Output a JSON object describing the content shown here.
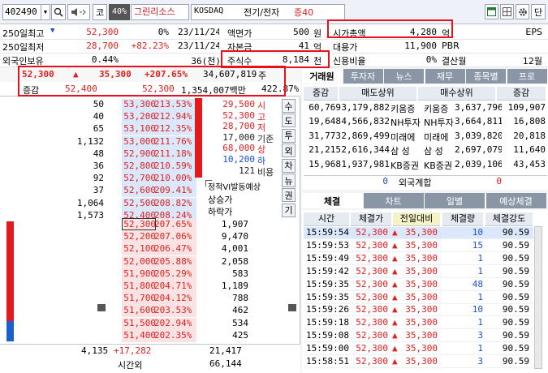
{
  "toolbar": {
    "code": "402490",
    "code_dropdown": "▼",
    "badge1": "코",
    "badge2": "40%",
    "stock_name": "그린리소스",
    "market": "KOSDAQ",
    "sector": "전기/전자",
    "margin": "증40"
  },
  "summary": {
    "left_rows": [
      {
        "label": "250일최고",
        "arrow": "▼",
        "price": "52,300",
        "pct": "0%",
        "date": "23/11/24"
      },
      {
        "label": "250일최저",
        "arrow": "",
        "price": "28,700",
        "pct": "+82.23%",
        "date": "23/11/24"
      },
      {
        "label": "외국인보유",
        "arrow": "",
        "price": "0.44%",
        "pct": "",
        "date": "36(천)"
      }
    ],
    "mid_rows": [
      {
        "label": "액면가",
        "value": "500",
        "unit": "원"
      },
      {
        "label": "자본금",
        "value": "41",
        "unit": "억"
      },
      {
        "label": "주식수",
        "value": "8,184",
        "unit": "천"
      }
    ],
    "right_rows": [
      {
        "label": "시가총액",
        "value": "4,280",
        "unit": "억",
        "label2": "EPS"
      },
      {
        "label": "대용가",
        "value": "11,900",
        "unit": "PBR",
        "label2": ""
      },
      {
        "label": "신용비율",
        "value": "0%",
        "unit": "결산월",
        "label2": "12월"
      }
    ]
  },
  "price_line": {
    "price": "52,300",
    "arrow": "▲",
    "change": "35,300",
    "pct": "+207.65%",
    "volume": "34,607,819",
    "vol_unit": "주"
  },
  "sub_line": {
    "label": "증감",
    "v1": "52,400",
    "v2": "52,300",
    "amount": "1,354,007백만",
    "ratio": "422.87%"
  },
  "orderbook": {
    "ask": [
      {
        "qty": "50",
        "price": "53,300",
        "pct": "213.53%",
        "bar": 0
      },
      {
        "qty": "40",
        "price": "53,200",
        "pct": "212.94%",
        "bar": 0
      },
      {
        "qty": "65",
        "price": "53,100",
        "pct": "212.35%",
        "bar": 0
      },
      {
        "qty": "1,132",
        "price": "53,000",
        "pct": "211.76%",
        "bar": 0
      },
      {
        "qty": "48",
        "price": "52,900",
        "pct": "211.18%",
        "bar": 0
      },
      {
        "qty": "36",
        "price": "52,800",
        "pct": "210.59%",
        "bar": 0
      },
      {
        "qty": "92",
        "price": "52,700",
        "pct": "210.00%",
        "bar": 0
      },
      {
        "qty": "37",
        "price": "52,600",
        "pct": "209.41%",
        "bar": 0
      },
      {
        "qty": "1,064",
        "price": "52,500",
        "pct": "208.82%",
        "bar": 0
      },
      {
        "qty": "1,573",
        "price": "52,400",
        "pct": "208.24%",
        "bar": 0
      }
    ],
    "bid": [
      {
        "qty": "1,907",
        "price": "52,300",
        "pct": "207.65%"
      },
      {
        "qty": "9,470",
        "price": "52,200",
        "pct": "207.06%"
      },
      {
        "qty": "4,001",
        "price": "52,100",
        "pct": "206.47%"
      },
      {
        "qty": "2,058",
        "price": "52,000",
        "pct": "205.88%"
      },
      {
        "qty": "583",
        "price": "51,900",
        "pct": "205.29%"
      },
      {
        "qty": "1,189",
        "price": "51,800",
        "pct": "204.71%"
      },
      {
        "qty": "788",
        "price": "51,700",
        "pct": "204.12%"
      },
      {
        "qty": "462",
        "price": "51,600",
        "pct": "203.53%"
      },
      {
        "qty": "534",
        "price": "51,500",
        "pct": "202.94%"
      },
      {
        "qty": "425",
        "price": "51,400",
        "pct": "202.35%"
      }
    ],
    "info": [
      {
        "label": "시",
        "value": "29,500",
        "cls": "red"
      },
      {
        "label": "고",
        "value": "52,300",
        "cls": "red"
      },
      {
        "label": "저",
        "value": "28,700",
        "cls": "red"
      },
      {
        "label": "기준",
        "value": "17,000",
        "cls": "dk"
      },
      {
        "label": "상",
        "value": "68,000",
        "cls": "red"
      },
      {
        "label": "하",
        "value": "10,200",
        "cls": "blue"
      },
      {
        "label": "비용",
        "value": "121",
        "cls": "dk"
      }
    ],
    "side_tabs": [
      "수",
      "도",
      "투",
      "외",
      "차",
      "뉴",
      "권",
      "기"
    ],
    "vi_label": "정적VI발동예상",
    "vi_up": "상승가",
    "vi_down": "하락가",
    "footer": {
      "ask_total": "4,135",
      "diff": "+17,282",
      "bid_total": "21,417",
      "time_label": "시간외",
      "after_total": "66,144"
    }
  },
  "right_tabs": [
    "거래원",
    "투자자",
    "뉴스",
    "재무",
    "종목별",
    "프로"
  ],
  "broker": {
    "headers": [
      "증감",
      "매도상위",
      "매수상위",
      "증감"
    ],
    "rows": [
      {
        "s_inc": "60,769",
        "s_qty": "3,179,882",
        "s_name": "키움증",
        "b_name": "키움증",
        "b_qty": "3,637,796",
        "b_inc": "109,907"
      },
      {
        "s_inc": "19,648",
        "s_qty": "4,566,832",
        "s_name": "NH투자",
        "b_name": "NH투자",
        "b_qty": "3,664,811",
        "b_inc": "16,808"
      },
      {
        "s_inc": "31,773",
        "s_qty": "2,869,499",
        "s_name": "미래에",
        "b_name": "미래에",
        "b_qty": "3,039,820",
        "b_inc": "20,818"
      },
      {
        "s_inc": "21,215",
        "s_qty": "2,616,344",
        "s_name": "삼 성",
        "b_name": "삼 성",
        "b_qty": "2,697,079",
        "b_inc": "11,640"
      },
      {
        "s_inc": "15,968",
        "s_qty": "1,937,981",
        "s_name": "KB증권",
        "b_name": "KB증권",
        "b_qty": "2,039,106",
        "b_inc": "43,453"
      }
    ],
    "foreign": {
      "left": "0",
      "label": "외국계합",
      "right": "0"
    }
  },
  "trade_tabs": [
    "체결",
    "차트",
    "일별",
    "예상체결"
  ],
  "trades": {
    "headers": [
      "시간",
      "체결가",
      "전일대비",
      "체결량",
      "체결강도"
    ],
    "rows": [
      {
        "time": "15:59:54",
        "price": "52,300",
        "arrow": "▲",
        "chg": "35,300",
        "qty": "10",
        "str": "90.59"
      },
      {
        "time": "15:59:53",
        "price": "52,300",
        "arrow": "▲",
        "chg": "35,300",
        "qty": "15",
        "str": "90.59"
      },
      {
        "time": "15:59:49",
        "price": "52,300",
        "arrow": "▲",
        "chg": "35,300",
        "qty": "1",
        "str": "90.59"
      },
      {
        "time": "15:59:42",
        "price": "52,300",
        "arrow": "▲",
        "chg": "35,300",
        "qty": "1",
        "str": "90.59"
      },
      {
        "time": "15:59:35",
        "price": "52,300",
        "arrow": "▲",
        "chg": "35,300",
        "qty": "48",
        "str": "90.59"
      },
      {
        "time": "15:59:35",
        "price": "52,300",
        "arrow": "▲",
        "chg": "35,300",
        "qty": "1",
        "str": "90.59"
      },
      {
        "time": "15:59:26",
        "price": "52,300",
        "arrow": "▲",
        "chg": "35,300",
        "qty": "10",
        "str": "90.59"
      },
      {
        "time": "15:59:18",
        "price": "52,300",
        "arrow": "▲",
        "chg": "35,300",
        "qty": "1",
        "str": "90.59"
      },
      {
        "time": "15:59:08",
        "price": "52,300",
        "arrow": "▲",
        "chg": "35,300",
        "qty": "3",
        "str": "90.59"
      },
      {
        "time": "15:59:00",
        "price": "52,300",
        "arrow": "▲",
        "chg": "35,300",
        "qty": "1",
        "str": "90.59"
      },
      {
        "time": "15:58:51",
        "price": "52,300",
        "arrow": "▲",
        "chg": "35,300",
        "qty": "3",
        "str": "90.59"
      }
    ]
  },
  "corner_btn": "단",
  "colors": {
    "ask_bg": "#dbe8fb",
    "bid_bg": "#fbe3e3",
    "accent_red": "#e0201f",
    "accent_blue": "#1a4fd0"
  }
}
